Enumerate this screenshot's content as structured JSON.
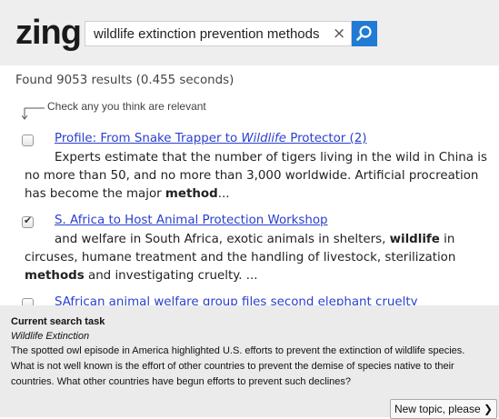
{
  "header": {
    "logo": "zing",
    "search_value": "wildlife extinction prevention methods",
    "clear_glyph": "×",
    "search_icon": "magnifier-icon"
  },
  "results_info": {
    "found_text": "Found 9053 results (0.455 seconds)",
    "hint": "Check any you think are relevant"
  },
  "results": [
    {
      "checked": false,
      "title_pre": "Profile: From Snake Trapper to ",
      "title_em": "Wildlife",
      "title_post": " Protector (2)",
      "snippet": [
        {
          "t": "Experts estimate that the number of tigers living in the wild in China is no more than 50, and no more than 3,000 worldwide. Artificial procreation has become the major ",
          "b": false
        },
        {
          "t": "method",
          "b": true
        },
        {
          "t": "...",
          "b": false
        }
      ]
    },
    {
      "checked": true,
      "title": "S. Africa to Host Animal Protection Workshop",
      "snippet": [
        {
          "t": "and welfare in South Africa, exotic animals in shelters, ",
          "b": false
        },
        {
          "t": "wildlife",
          "b": true
        },
        {
          "t": " in circuses, humane treatment and the handling of livestock, sterilization ",
          "b": false
        },
        {
          "t": "methods",
          "b": true
        },
        {
          "t": " and investigating cruelty. ...",
          "b": false
        }
      ]
    },
    {
      "checked": false,
      "title": "SAfrican animal welfare group files second elephant cruelty"
    }
  ],
  "task": {
    "heading": "Current search task",
    "topic": "Wildlife Extinction",
    "description": "The spotted owl episode in America highlighted U.S. efforts to prevent the extinction of wildlife species. What is not well known is the effort of other countries to prevent the demise of species native to their countries. What other countries have begun efforts to prevent such declines?",
    "new_topic_label": "New topic, please ❯"
  },
  "colors": {
    "accent": "#1f7bd4",
    "link": "#2a3fcf",
    "header_bg": "#eeeeee",
    "panel_bg": "#ebebeb"
  }
}
